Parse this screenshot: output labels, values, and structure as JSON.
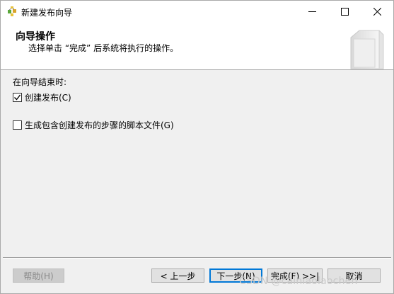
{
  "window": {
    "title": "新建发布向导",
    "minimize_glyph": "─",
    "maximize_glyph": "☐",
    "close_glyph": "✕",
    "icon": "wizard-app-icon"
  },
  "header": {
    "title": "向导操作",
    "subtitle": "选择单击 “完成” 后系统将执行的操作。",
    "graphic": "book-icon"
  },
  "body": {
    "section_label": "在向导结束时:",
    "options": [
      {
        "label": "创建发布(C)",
        "checked": true
      },
      {
        "label": "生成包含创建发布的步骤的脚本文件(G)",
        "checked": false
      }
    ]
  },
  "buttons": {
    "help": "帮助(H)",
    "prev": "< 上一步",
    "next": "下一步(N)",
    "finish": "完成(F) >>|",
    "cancel": "取消"
  },
  "watermark": "CSDN @cainiaolaochen",
  "colors": {
    "accent": "#0078d7",
    "background": "#f0f0f0",
    "header_bg": "#ffffff"
  }
}
